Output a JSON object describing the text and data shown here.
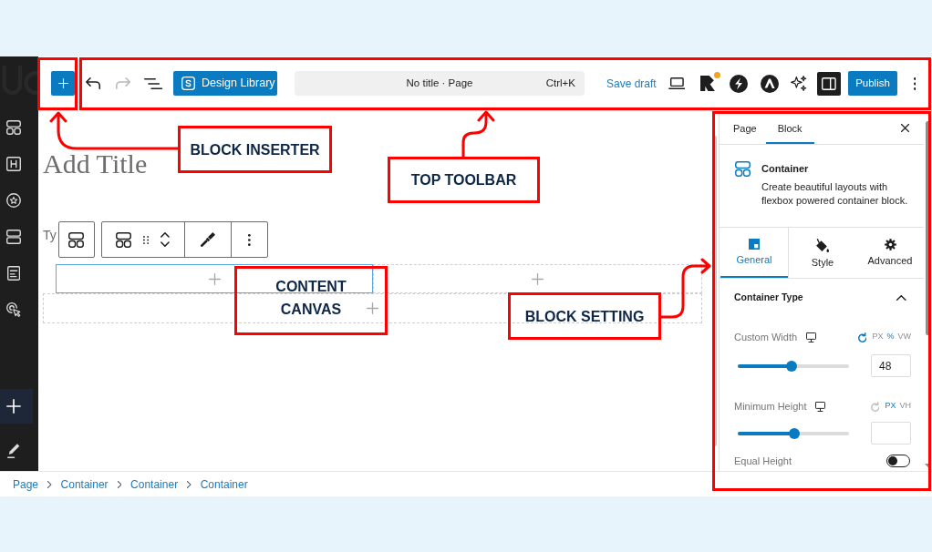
{
  "sidebar": {
    "items": [
      {
        "selected": false
      },
      {
        "selected": false
      },
      {
        "selected": false
      },
      {
        "selected": false
      },
      {
        "selected": false
      },
      {
        "selected": false
      },
      {
        "selected": true
      },
      {
        "selected": false
      }
    ]
  },
  "toolbar": {
    "undo": {
      "disabled": false
    },
    "redo": {
      "disabled": true
    },
    "design_library": "Design Library",
    "command_bar": {
      "title": "No title · Page",
      "shortcut": "Ctrl+K"
    },
    "save_draft": "Save draft",
    "plugins": [
      {
        "badge": true
      },
      {
        "badge": false
      },
      {
        "badge": false
      }
    ],
    "settings_toggle": {
      "on": true
    },
    "publish": "Publish"
  },
  "canvas": {
    "title_placeholder": "Add Title",
    "paragraph_placeholder": "Ty",
    "container_rows": [
      {
        "containers": [
          {
            "selected": true
          },
          {
            "selected": false
          }
        ]
      },
      {
        "containers": [
          {
            "selected": false
          }
        ]
      }
    ]
  },
  "inspector": {
    "tabs": [
      {
        "label": "Page",
        "selected": false
      },
      {
        "label": "Block",
        "selected": true
      }
    ],
    "block": {
      "name": "Container",
      "description": "Create beautiful layouts with flexbox powered container block."
    },
    "setting_tabs": [
      {
        "label": "General",
        "selected": true
      },
      {
        "label": "Style",
        "selected": false
      },
      {
        "label": "Advanced",
        "selected": false
      }
    ],
    "panel": {
      "title": "Container Type",
      "expanded": true,
      "controls": [
        {
          "kind": "range",
          "label": "Custom Width",
          "reset_active": true,
          "units": [
            {
              "label": "PX",
              "selected": false
            },
            {
              "label": "%",
              "selected": true
            },
            {
              "label": "VW",
              "selected": false
            }
          ],
          "level": 0.48,
          "value": "48"
        },
        {
          "kind": "range",
          "label": "Minimum Height",
          "reset_active": false,
          "units": [
            {
              "label": "PX",
              "selected": true
            },
            {
              "label": "VH",
              "selected": false
            }
          ],
          "level": 0.51
        },
        {
          "kind": "toggle",
          "label": "Equal Height",
          "on": false
        }
      ]
    }
  },
  "breadcrumb": [
    "Page",
    "Container",
    "Container",
    "Container"
  ],
  "annotations": [
    {
      "label": "BLOCK INSERTER"
    },
    {
      "label": "TOP TOOLBAR"
    },
    {
      "label": "CONTENT CANVAS"
    },
    {
      "label": "BLOCK SETTING"
    }
  ]
}
